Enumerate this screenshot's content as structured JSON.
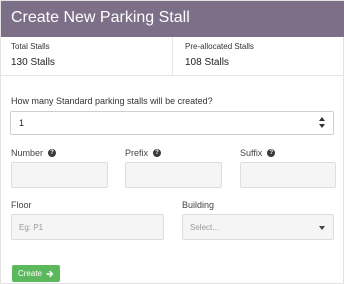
{
  "header": {
    "title": "Create New Parking Stall"
  },
  "stats": {
    "total_label": "Total Stalls",
    "total_value": "130 Stalls",
    "preallocated_label": "Pre-allocated Stalls",
    "preallocated_value": "108 Stalls"
  },
  "form": {
    "question": "How many Standard parking stalls will be created?",
    "count_value": "1",
    "number_label": "Number",
    "prefix_label": "Prefix",
    "suffix_label": "Suffix",
    "floor_label": "Floor",
    "floor_placeholder": "Eg: P1",
    "building_label": "Building",
    "building_selected": "Select...",
    "create_label": "Create"
  },
  "colors": {
    "header_bg": "#7d6f88",
    "create_button": "#5cb85c"
  },
  "icons": {
    "help": "question-circle-icon",
    "create": "arrow-right-icon",
    "select": "chevron-down-icon",
    "spinner": "up-down-arrows-icon"
  }
}
